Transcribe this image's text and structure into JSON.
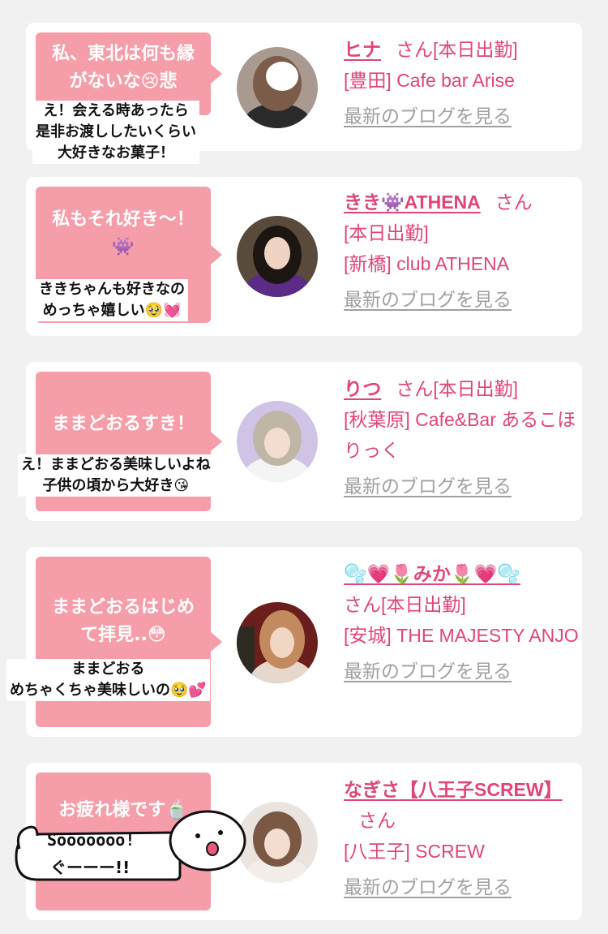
{
  "cards": [
    {
      "bubble": "私、東北は何も縁がないな😢悲",
      "overlay": [
        "え！会える時あったら",
        "是非お渡ししたいくらい",
        "大好きなお菓子！"
      ],
      "name": "ヒナ",
      "san": "さん",
      "status": "[本日出勤]",
      "shop": "[豊田] Cafe bar Arise",
      "blog": "最新のブログを見る"
    },
    {
      "bubble": "私もそれ好き〜！👾",
      "overlay": [
        "ききちゃんも好きなの",
        "めっちゃ嬉しい🥹💓"
      ],
      "name": "きき👾ATHENA",
      "san": "さん",
      "status": "[本日出勤]",
      "shop": "[新橋] club ATHENA",
      "blog": "最新のブログを見る"
    },
    {
      "bubble": "ままどおるすき！",
      "overlay": [
        "え！ままどおる美味しいよね",
        "子供の頃から大好き😘"
      ],
      "name": "りつ",
      "san": "さん",
      "status": "[本日出勤]",
      "shop": "[秋葉原] Cafe&Bar あるこほりっく",
      "blog": "最新のブログを見る"
    },
    {
      "bubble": "ままどおるはじめて拝見..😳",
      "overlay": [
        "ままどおる",
        "めちゃくちゃ美味しいの🥹💕"
      ],
      "name": "🫧💗🌷みか🌷💗🫧",
      "san": "さん",
      "status": "[本日出勤]",
      "shop": "[安城] THE MAJESTY ANJO",
      "blog": "最新のブログを見る"
    },
    {
      "bubble": "お疲れ様です🍵",
      "overlay": [],
      "name": "なぎさ【八王子SCREW】",
      "san": "さん",
      "status": "",
      "shop": "[八王子] SCREW",
      "blog": "最新のブログを見る"
    }
  ],
  "sticker": {
    "text1": "Sooooooo!",
    "text2": "ぐーーー!!"
  },
  "colors": {
    "background": "#f1f1f1",
    "bubble": "#f59ea9",
    "name": "#e0457a",
    "blog_link": "#a0a0a0"
  }
}
